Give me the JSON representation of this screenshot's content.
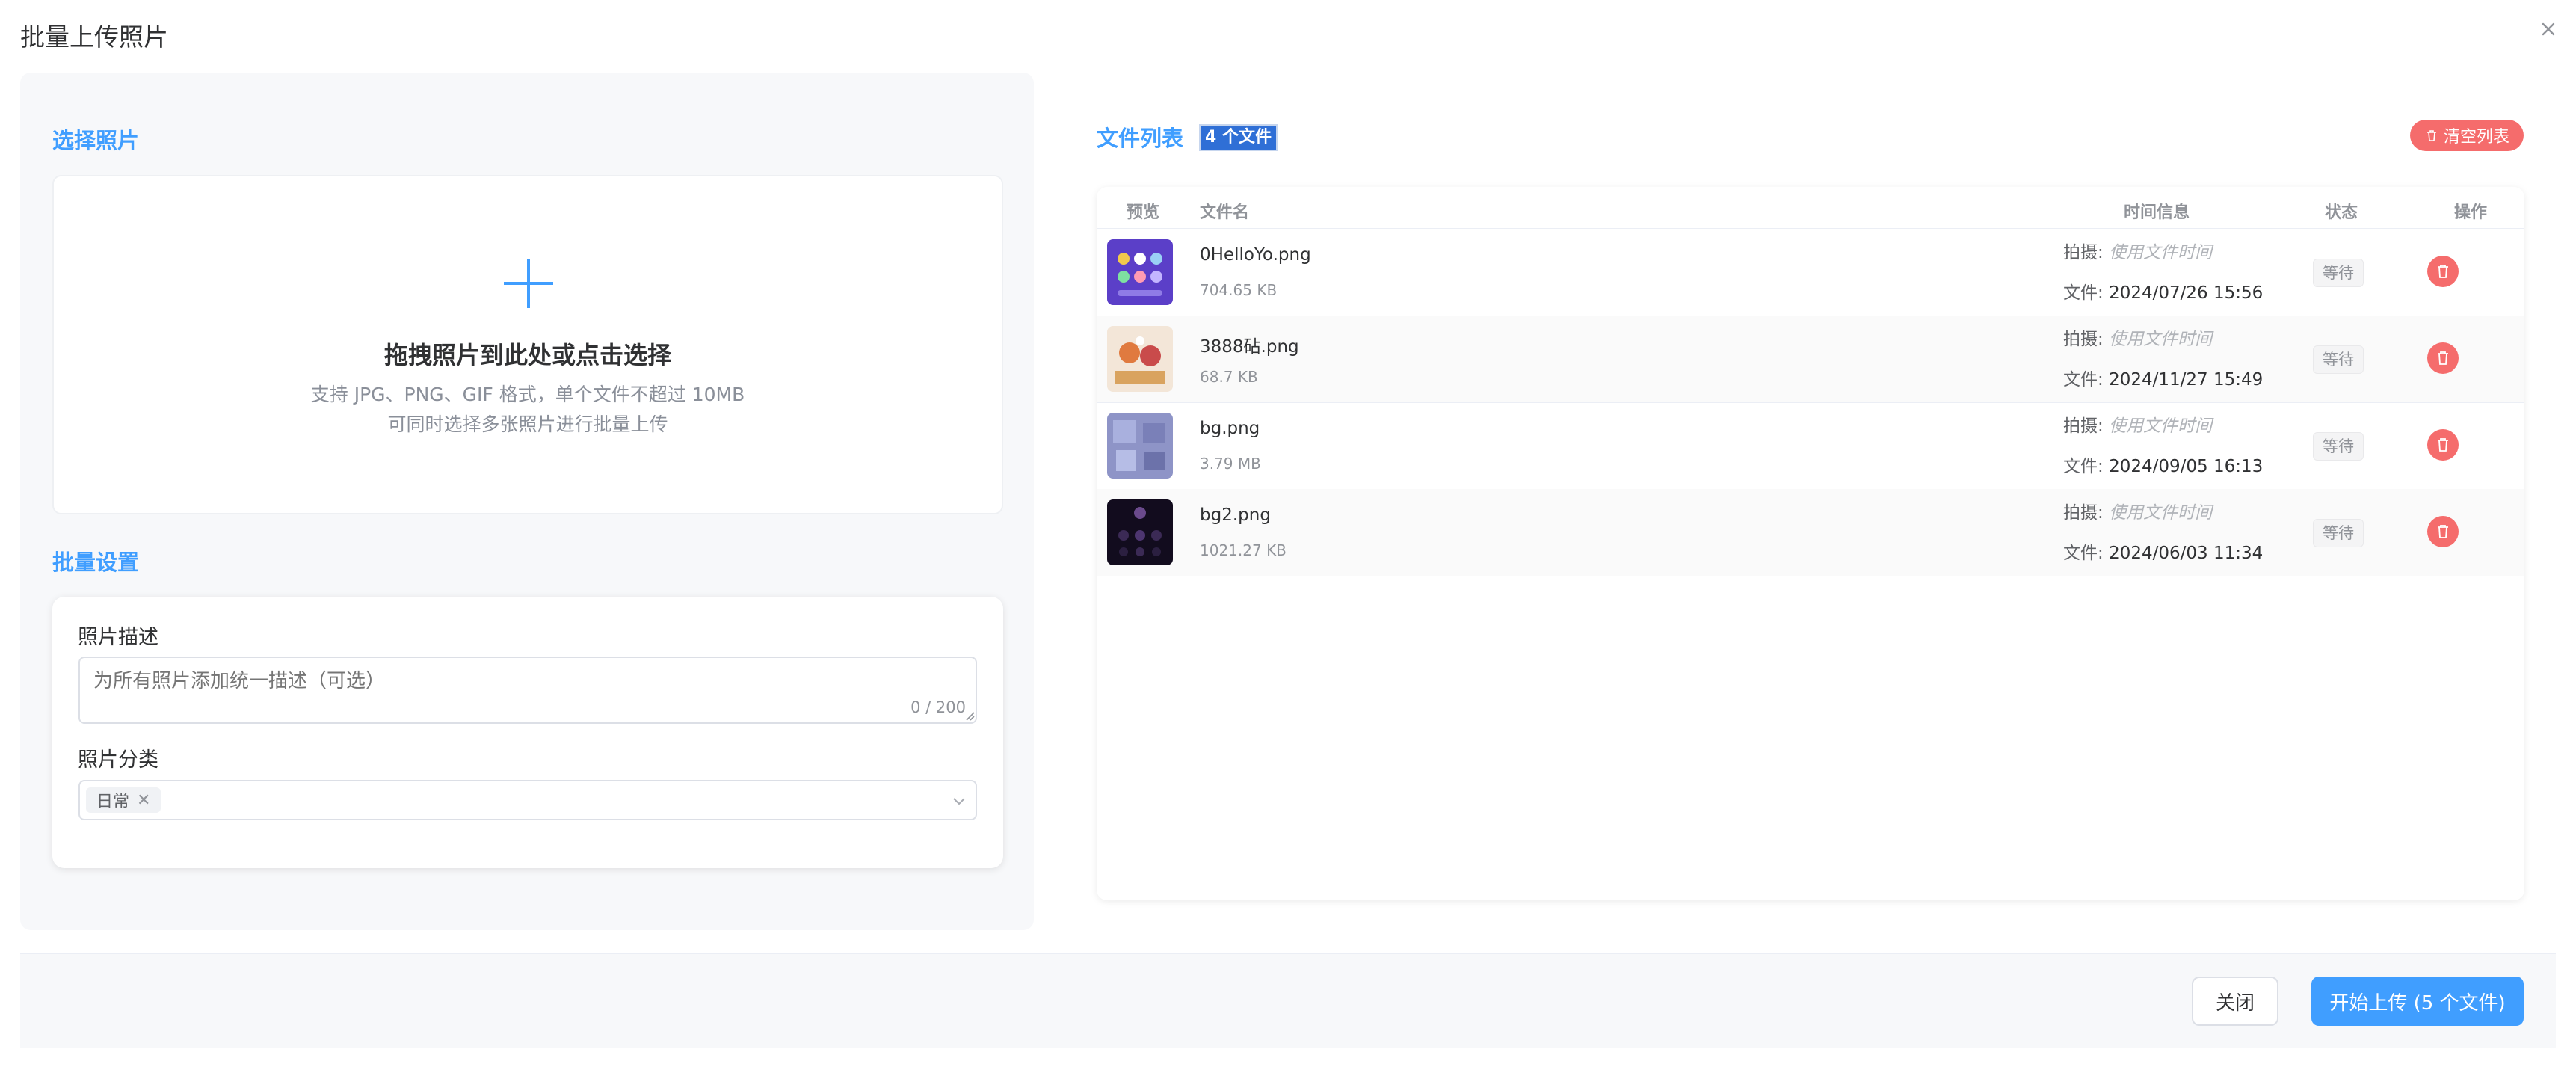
{
  "dialog": {
    "title": "批量上传照片"
  },
  "left": {
    "select_title": "选择照片",
    "upload": {
      "main": "拖拽照片到此处或点击选择",
      "sub1": "支持 JPG、PNG、GIF 格式，单个文件不超过 10MB",
      "sub2": "可同时选择多张照片进行批量上传"
    },
    "settings_title": "批量设置",
    "desc_label": "照片描述",
    "desc_placeholder": "为所有照片添加统一描述（可选）",
    "desc_counter": "0 / 200",
    "category_label": "照片分类",
    "category_tag": "日常"
  },
  "right": {
    "title": "文件列表",
    "count": "4 个文件",
    "clear_label": "清空列表",
    "columns": {
      "preview": "预览",
      "filename": "文件名",
      "time": "时间信息",
      "status": "状态",
      "action": "操作"
    },
    "shot_label": "拍摄:",
    "file_label": "文件:",
    "rows": [
      {
        "name": "0HelloYo.png",
        "size": "704.65 KB",
        "shot": "使用文件时间",
        "file_time": "2024/07/26 15:56",
        "status": "等待"
      },
      {
        "name": "3888砧.png",
        "size": "68.7 KB",
        "shot": "使用文件时间",
        "file_time": "2024/11/27 15:49",
        "status": "等待"
      },
      {
        "name": "bg.png",
        "size": "3.79 MB",
        "shot": "使用文件时间",
        "file_time": "2024/09/05 16:13",
        "status": "等待"
      },
      {
        "name": "bg2.png",
        "size": "1021.27 KB",
        "shot": "使用文件时间",
        "file_time": "2024/06/03 11:34",
        "status": "等待"
      }
    ]
  },
  "footer": {
    "close_label": "关闭",
    "upload_label": "开始上传 (5 个文件)"
  },
  "colors": {
    "accent": "#409eff",
    "danger": "#f56c6c",
    "panel_bg": "#f7f8fa"
  }
}
